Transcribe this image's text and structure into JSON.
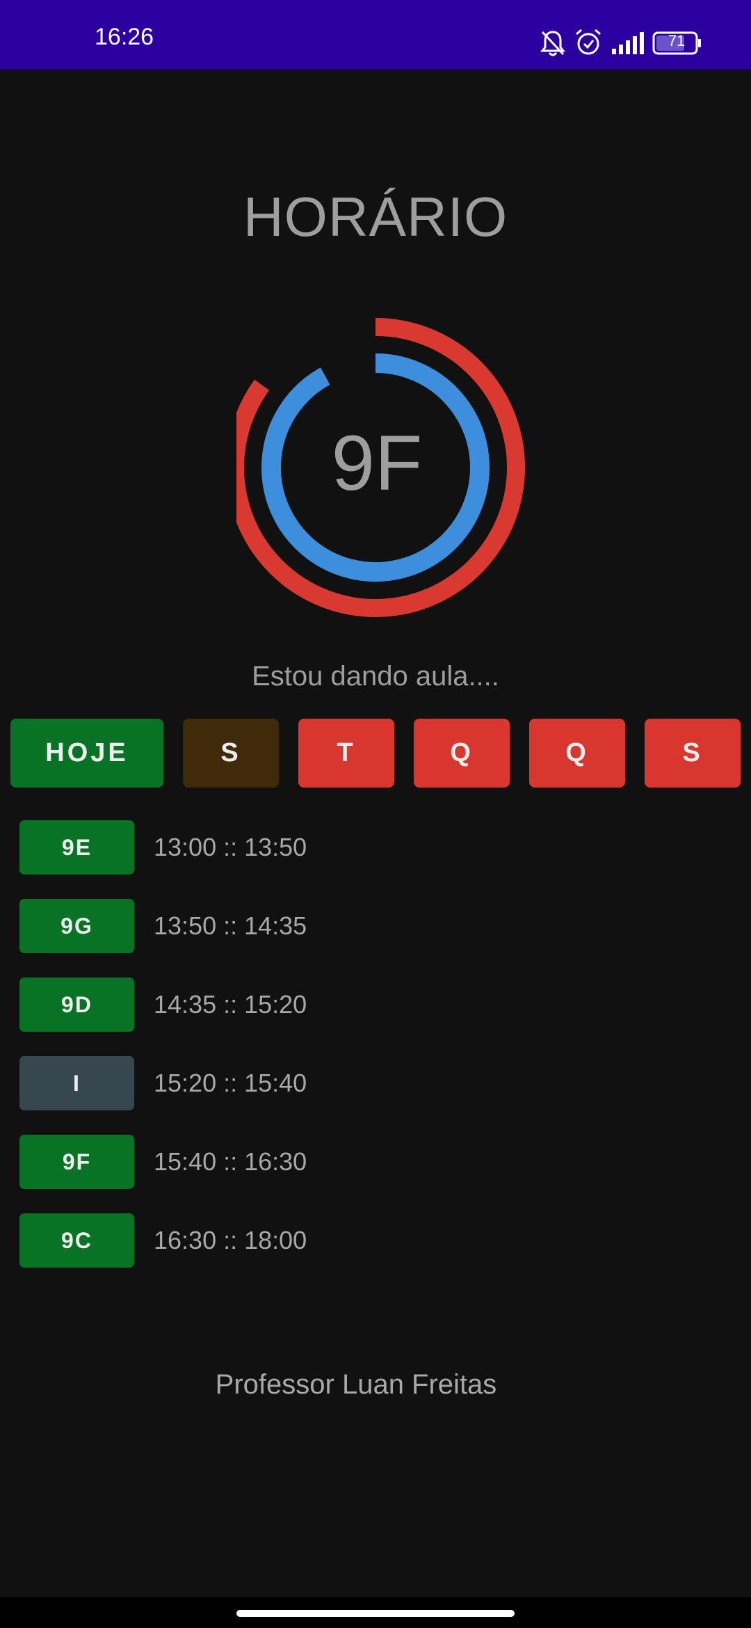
{
  "status_bar": {
    "time": "16:26",
    "battery": "71",
    "icons": [
      "bell-off-icon",
      "alarm-icon",
      "signal-icon",
      "battery-icon"
    ],
    "background": "#2c00a0"
  },
  "header": {
    "title": "HORÁRIO"
  },
  "progress": {
    "current_class": "9F",
    "outer_ring": {
      "fraction": 0.85,
      "color": "#d9392f"
    },
    "inner_ring": {
      "fraction": 0.92,
      "color": "#3d8fdd"
    },
    "message": "Estou dando aula...."
  },
  "days": [
    {
      "label": "HOJE",
      "color": "#087324",
      "state": "today"
    },
    {
      "label": "S",
      "color": "#3f2a0a",
      "state": "selected"
    },
    {
      "label": "T",
      "color": "#d9372e",
      "state": "default"
    },
    {
      "label": "Q",
      "color": "#d9372e",
      "state": "default"
    },
    {
      "label": "Q",
      "color": "#d9372e",
      "state": "default"
    },
    {
      "label": "S",
      "color": "#d9372e",
      "state": "default"
    }
  ],
  "schedule": [
    {
      "class": "9E",
      "time": "13:00 :: 13:50",
      "color": "#087324"
    },
    {
      "class": "9G",
      "time": "13:50 :: 14:35",
      "color": "#087324"
    },
    {
      "class": "9D",
      "time": "14:35 :: 15:20",
      "color": "#087324"
    },
    {
      "class": "I",
      "time": "15:20 :: 15:40",
      "color": "#37474f"
    },
    {
      "class": "9F",
      "time": "15:40 :: 16:30",
      "color": "#087324"
    },
    {
      "class": "9C",
      "time": "16:30 :: 18:00",
      "color": "#087324"
    }
  ],
  "footer": {
    "credit": "Professor Luan Freitas"
  }
}
